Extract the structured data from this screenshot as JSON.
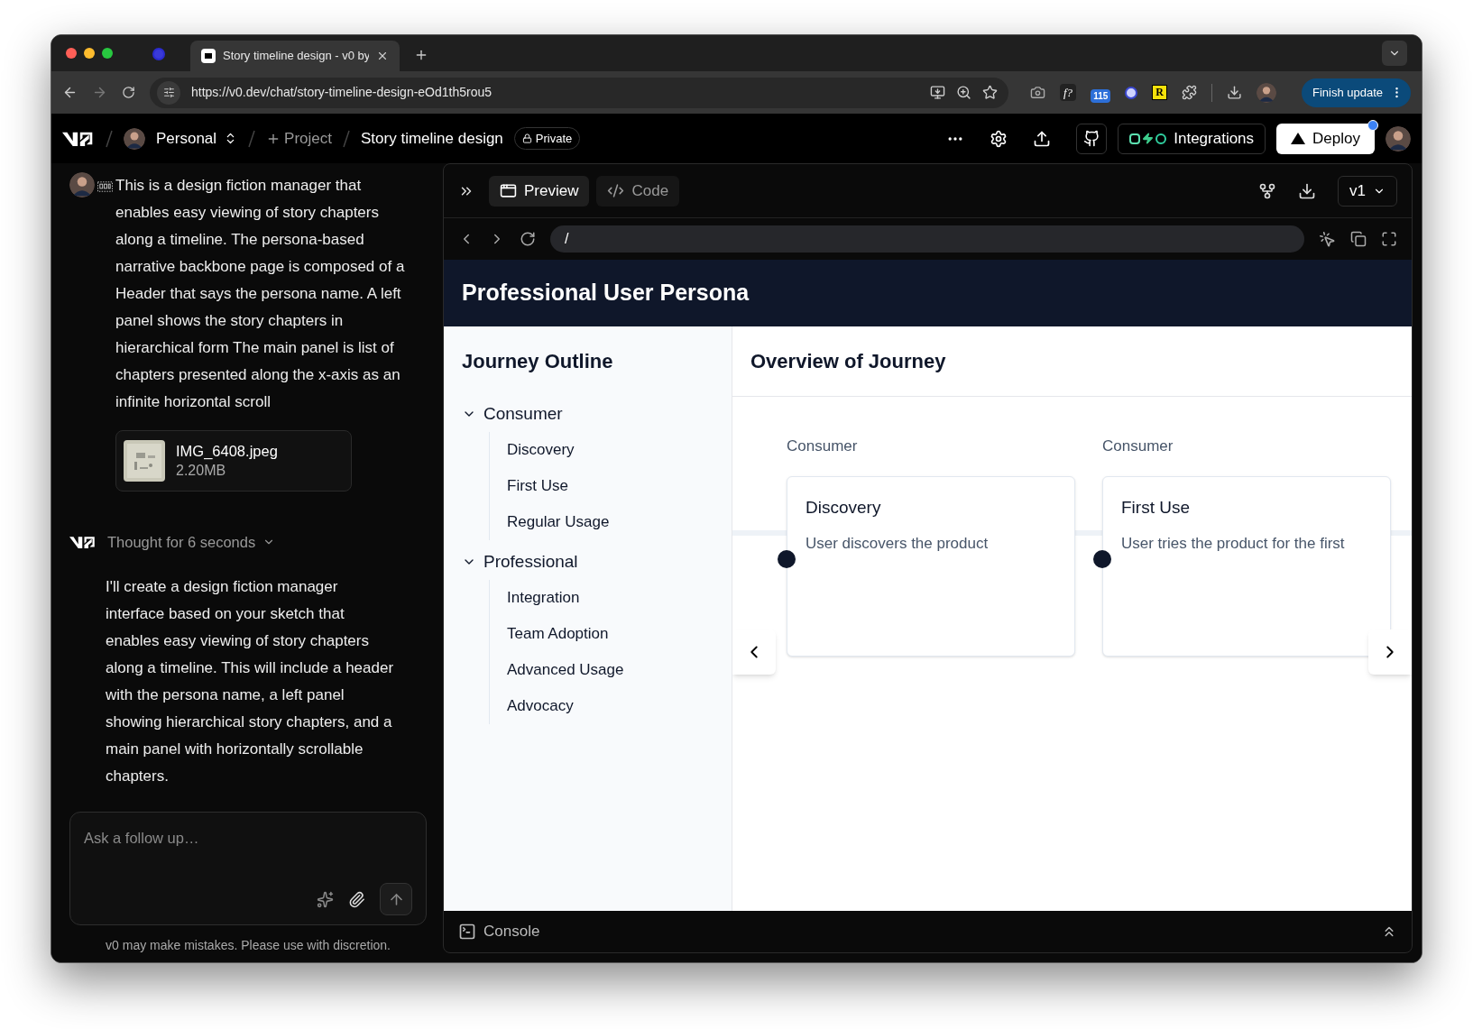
{
  "browser": {
    "tab": {
      "title": "Story timeline design - v0 by"
    },
    "url": "https://v0.dev/chat/story-timeline-design-eOd1th5rou5",
    "extension_glyph": "f?",
    "extension_badge": "115",
    "extension_letter": "R",
    "update_button": "Finish update"
  },
  "app_header": {
    "workspace": "Personal",
    "project": "Project",
    "chat_title": "Story timeline design",
    "visibility": "Private",
    "integrations": "Integrations",
    "deploy": "Deploy",
    "deploy_notification": true
  },
  "chat": {
    "messages": [
      {
        "kind": "user",
        "text": "This is a design fiction manager that enables easy viewing of story chapters along a timeline. The persona-based narrative backbone page is composed of a Header that says the persona name. A left panel shows the story chapters in hierarchical form The main panel is list of chapters presented along the x-axis as an infinite horizontal scroll",
        "attachment": {
          "name": "IMG_6408.jpeg",
          "size": "2.20MB"
        }
      },
      {
        "kind": "assistant",
        "thought": "Thought for 6 seconds",
        "text": "I'll create a design fiction manager interface based on your sketch that enables easy viewing of story chapters along a timeline. This will include a header with the persona name, a left panel showing hierarchical story chapters, and a main panel with horizontally scrollable chapters."
      }
    ],
    "input": {
      "placeholder": "Ask a follow up…"
    },
    "disclaimer": "v0 may make mistakes. Please use with discretion."
  },
  "preview": {
    "tabs": [
      {
        "label": "Preview",
        "selected": true
      },
      {
        "label": "Code",
        "selected": false
      }
    ],
    "version": "v1",
    "path": "/",
    "console": "Console",
    "page": {
      "title": "Professional User Persona",
      "outline_title": "Journey Outline",
      "groups": [
        {
          "label": "Consumer",
          "expanded": true,
          "children": [
            {
              "label": "Discovery"
            },
            {
              "label": "First Use"
            },
            {
              "label": "Regular Usage"
            }
          ]
        },
        {
          "label": "Professional",
          "expanded": true,
          "children": [
            {
              "label": "Integration"
            },
            {
              "label": "Team Adoption"
            },
            {
              "label": "Advanced Usage"
            },
            {
              "label": "Advocacy"
            }
          ]
        }
      ],
      "overview_title": "Overview of Journey",
      "chapters": [
        {
          "group": "Consumer",
          "title": "Discovery",
          "description": "User discovers the product"
        },
        {
          "group": "Consumer",
          "title": "First Use",
          "description": "User tries the product for the first"
        }
      ]
    }
  }
}
